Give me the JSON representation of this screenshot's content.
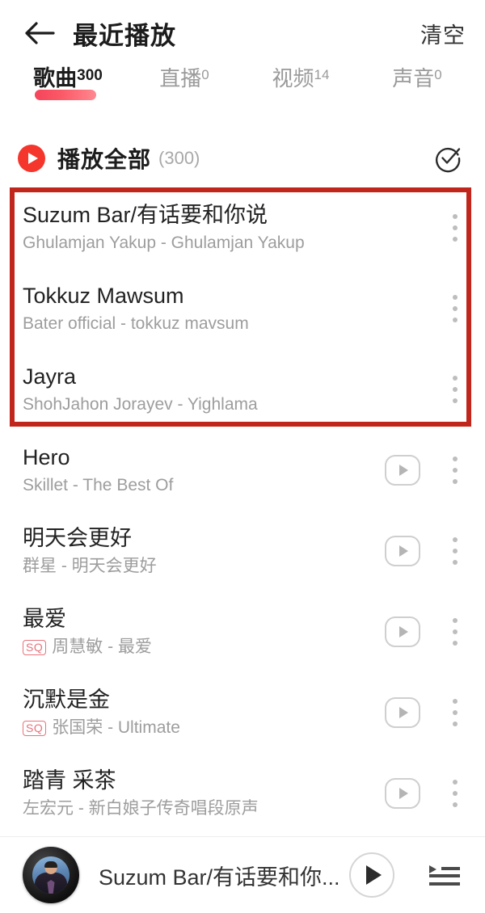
{
  "header": {
    "back_icon": "back-arrow-icon",
    "title": "最近播放",
    "clear_label": "清空"
  },
  "tabs": [
    {
      "label": "歌曲",
      "count": "300",
      "active": true
    },
    {
      "label": "直播",
      "count": "0",
      "active": false
    },
    {
      "label": "视频",
      "count": "14",
      "active": false
    },
    {
      "label": "声音",
      "count": "0",
      "active": false
    }
  ],
  "play_all": {
    "play_icon": "play-circle-icon",
    "label": "播放全部",
    "count": "(300)",
    "select_icon": "check-circle-select-icon"
  },
  "songs": [
    {
      "title": "Suzum Bar/有话要和你说",
      "subtitle": "Ghulamjan Yakup - Ghulamjan Yakup",
      "sq": false,
      "has_play": false
    },
    {
      "title": "Tokkuz Mawsum",
      "subtitle": "Bater official - tokkuz mavsum",
      "sq": false,
      "has_play": false
    },
    {
      "title": "Jayra",
      "subtitle": "ShohJahon Jorayev - Yighlama",
      "sq": false,
      "has_play": false
    },
    {
      "title": "Hero",
      "subtitle": "Skillet - The Best Of",
      "sq": false,
      "has_play": true
    },
    {
      "title": "明天会更好",
      "subtitle": "群星 - 明天会更好",
      "sq": false,
      "has_play": true
    },
    {
      "title": "最爱",
      "subtitle": "周慧敏 - 最爱",
      "sq": true,
      "sq_label": "SQ",
      "has_play": true
    },
    {
      "title": "沉默是金",
      "subtitle": "张国荣 - Ultimate",
      "sq": true,
      "sq_label": "SQ",
      "has_play": true
    },
    {
      "title": "踏青 采茶",
      "subtitle": "左宏元 - 新白娘子传奇唱段原声",
      "sq": false,
      "has_play": true
    }
  ],
  "player": {
    "album_art": "album-art-avatar",
    "now_playing": "Suzum Bar/有话要和你...",
    "play_icon": "play-icon",
    "queue_icon": "playlist-queue-icon"
  },
  "annotation": {
    "type": "highlight-box",
    "color": "#c1261c"
  },
  "colors": {
    "accent_red": "#f4362c",
    "tab_underline": "#f5445a",
    "sq_badge": "#e8727c",
    "annotation": "#c1261c"
  }
}
